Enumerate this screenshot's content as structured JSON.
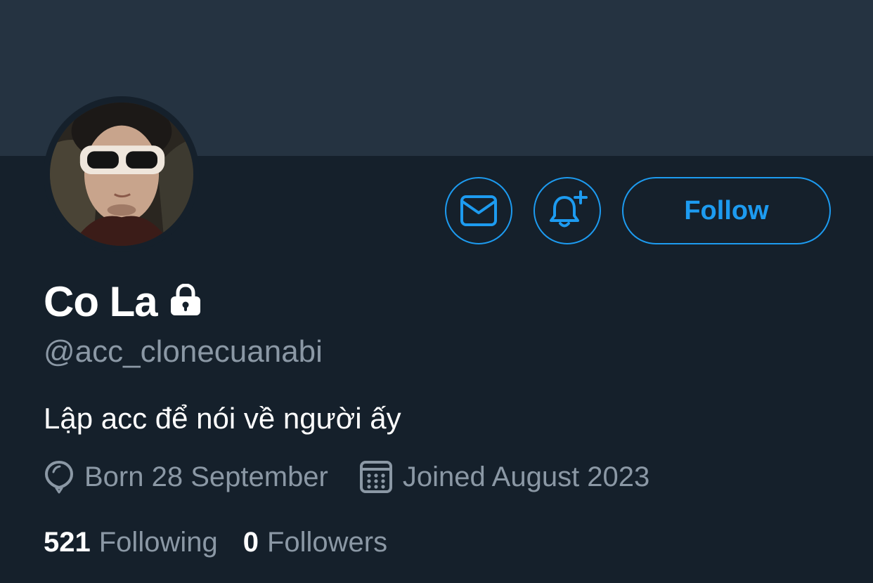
{
  "profile": {
    "display_name": "Co La",
    "handle": "@acc_clonecuanabi",
    "bio": "Lập acc để nói về người ấy",
    "protected_icon": "lock-icon",
    "avatar_icon": "profile-photo"
  },
  "actions": {
    "message_icon": "envelope-icon",
    "notify_icon": "bell-plus-icon",
    "follow_label": "Follow"
  },
  "meta": {
    "birthday_icon": "balloon-icon",
    "birthday": "Born 28 September",
    "joined_icon": "calendar-icon",
    "joined": "Joined August 2023"
  },
  "stats": {
    "following_count": "521",
    "following_label": "Following",
    "followers_count": "0",
    "followers_label": "Followers"
  },
  "colors": {
    "background": "#15202b",
    "banner": "#253341",
    "accent": "#1d9bf0",
    "text_primary": "#ffffff",
    "text_secondary": "#8b98a5"
  }
}
